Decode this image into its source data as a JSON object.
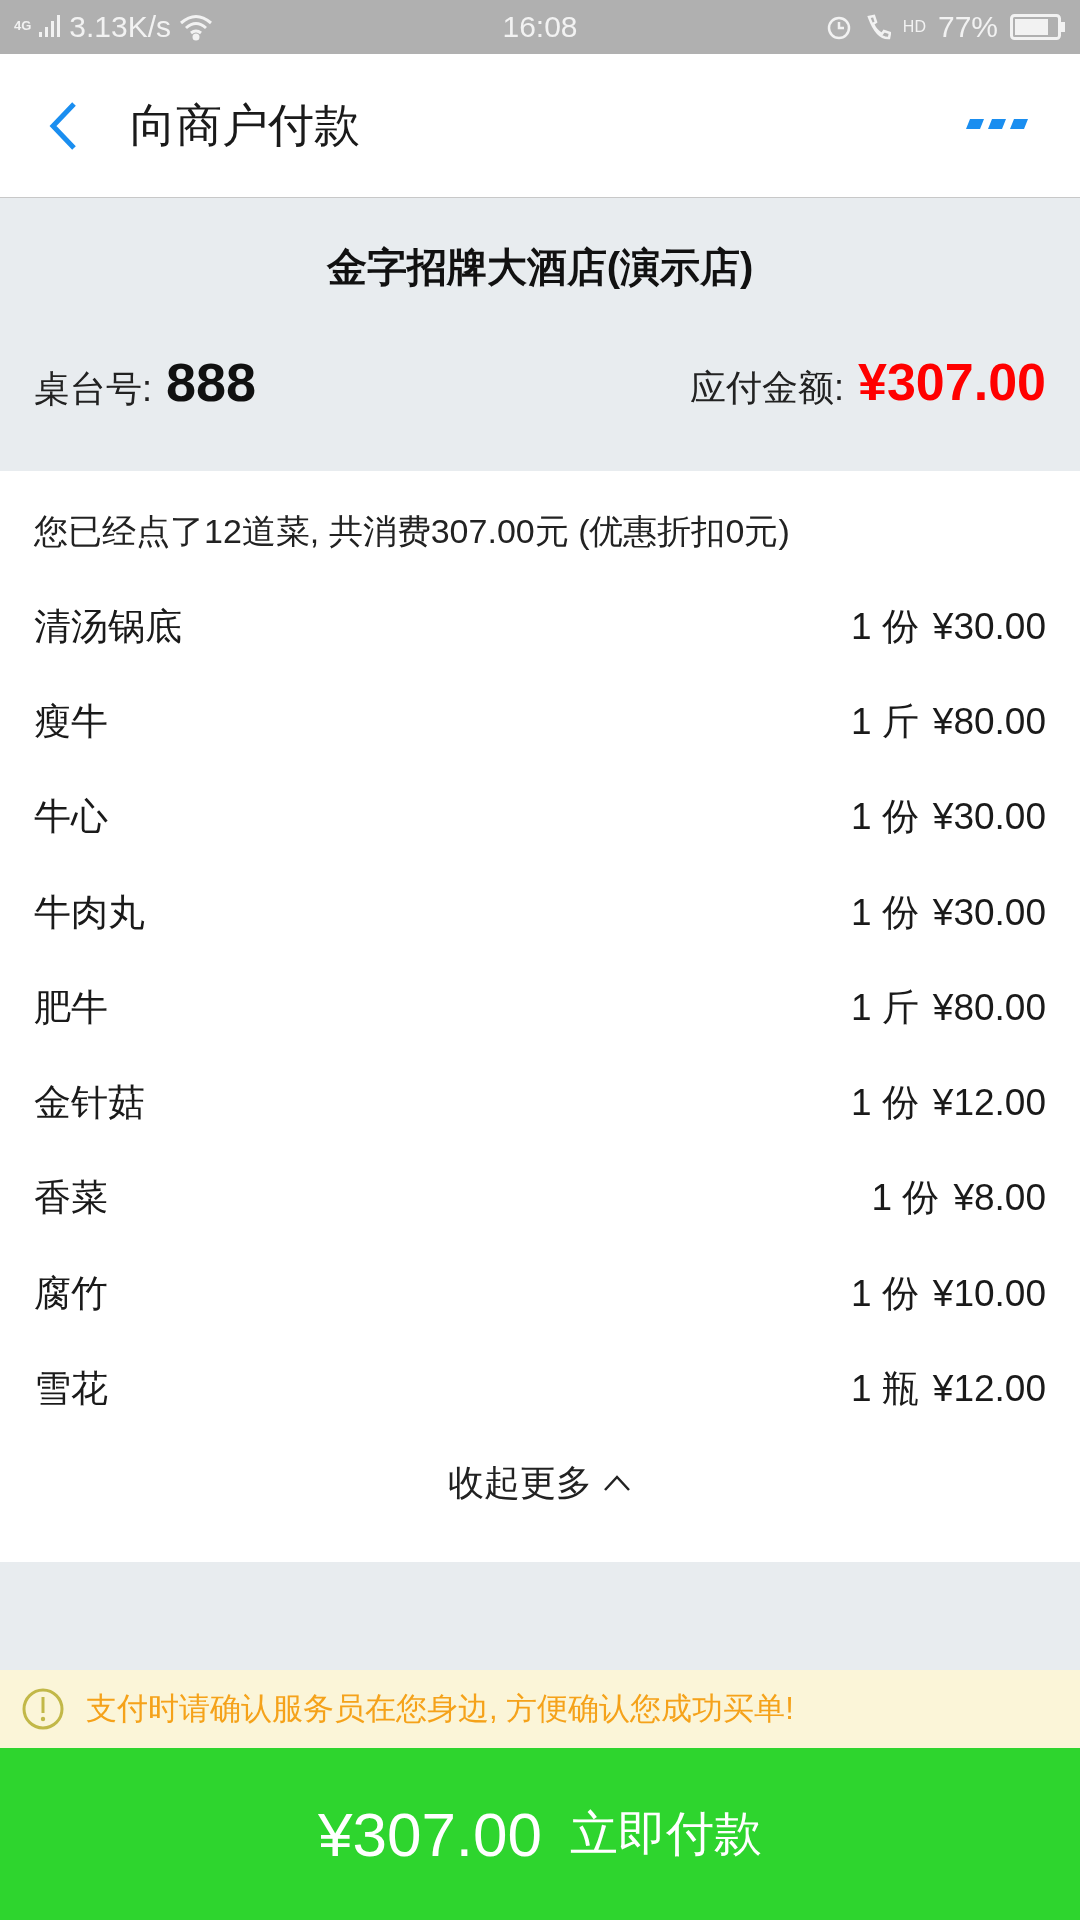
{
  "status_bar": {
    "network": "4G",
    "speed": "3.13K/s",
    "time": "16:08",
    "hd": "HD",
    "battery": "77%"
  },
  "header": {
    "title": "向商户付款"
  },
  "shop": {
    "name": "金字招牌大酒店(演示店)",
    "table_label": "桌台号:",
    "table_number": "888",
    "amount_label": "应付金额:",
    "amount": "¥307.00"
  },
  "order": {
    "summary": "您已经点了12道菜, 共消费307.00元 (优惠折扣0元)",
    "items": [
      {
        "name": "清汤锅底",
        "quantity": "1 份",
        "price": "¥30.00"
      },
      {
        "name": "瘦牛",
        "quantity": "1 斤",
        "price": "¥80.00"
      },
      {
        "name": "牛心",
        "quantity": "1 份",
        "price": "¥30.00"
      },
      {
        "name": "牛肉丸",
        "quantity": "1 份",
        "price": "¥30.00"
      },
      {
        "name": "肥牛",
        "quantity": "1 斤",
        "price": "¥80.00"
      },
      {
        "name": "金针菇",
        "quantity": "1 份",
        "price": "¥12.00"
      },
      {
        "name": "香菜",
        "quantity": "1 份",
        "price": "¥8.00"
      },
      {
        "name": "腐竹",
        "quantity": "1 份",
        "price": "¥10.00"
      },
      {
        "name": "雪花",
        "quantity": "1 瓶",
        "price": "¥12.00"
      }
    ],
    "toggle": {
      "label": "收起更多",
      "expanded": true
    }
  },
  "notice": "支付时请确认服务员在您身边, 方便确认您成功买单!",
  "pay_button": {
    "amount": "¥307.00",
    "label": "立即付款"
  }
}
